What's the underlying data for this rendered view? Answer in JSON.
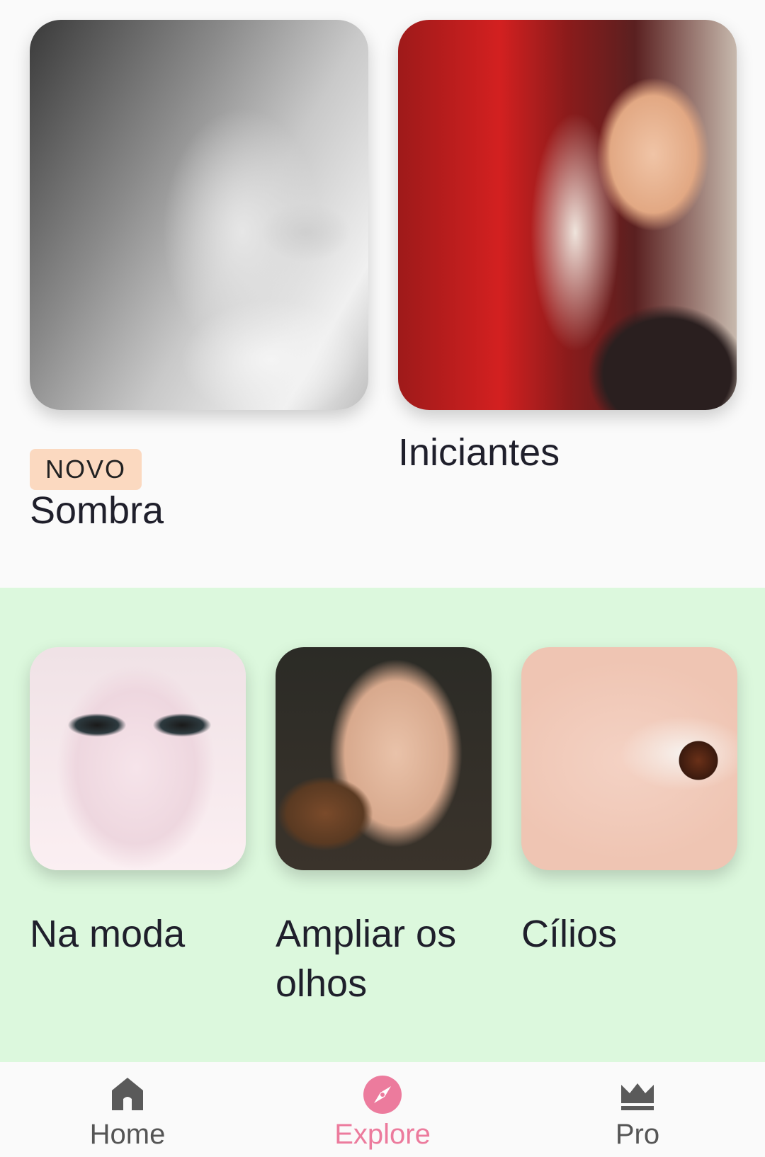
{
  "cards_top": [
    {
      "badge": "NOVO",
      "label": "Sombra"
    },
    {
      "label": "Iniciantes"
    }
  ],
  "cards_bottom": [
    {
      "label": "Na moda"
    },
    {
      "label": "Ampliar os olhos"
    },
    {
      "label": "Cílios"
    }
  ],
  "bottom_nav": {
    "items": [
      {
        "label": "Home",
        "icon": "home-icon"
      },
      {
        "label": "Explore",
        "icon": "compass-icon",
        "active": true
      },
      {
        "label": "Pro",
        "icon": "crown-icon"
      }
    ],
    "active_color": "#ec7b9d",
    "inactive_color": "#555555"
  },
  "colors": {
    "badge_bg": "#fbd9c0",
    "green_section_bg": "#dcf8dd"
  }
}
